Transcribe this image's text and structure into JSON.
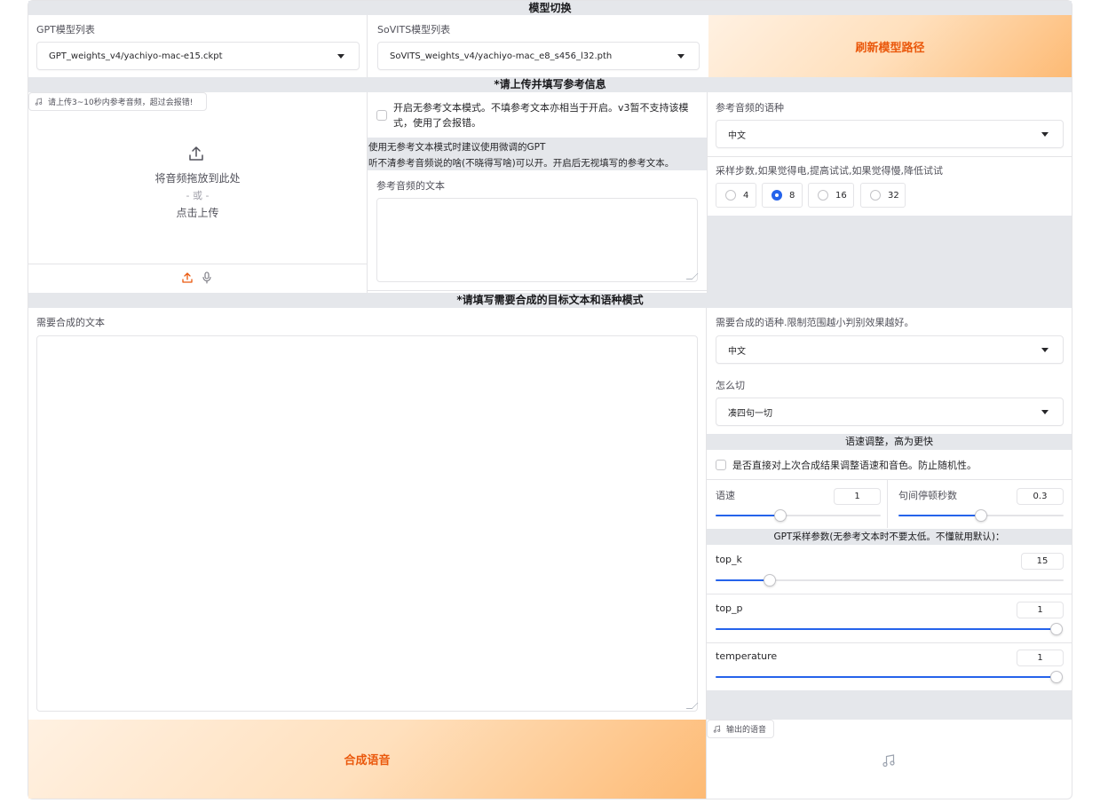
{
  "header": {
    "title": "模型切换"
  },
  "models": {
    "gpt_label": "GPT模型列表",
    "gpt_value": "GPT_weights_v4/yachiyo-mac-e15.ckpt",
    "sovits_label": "SoVITS模型列表",
    "sovits_value": "SoVITS_weights_v4/yachiyo-mac_e8_s456_l32.pth",
    "refresh_label": "刷新模型路径"
  },
  "reference": {
    "section_title": "*请上传并填写参考信息",
    "upload_tag": "请上传3~10秒内参考音频，超过会报错!",
    "drop_text": "将音频拖放到此处",
    "or_text": "- 或 -",
    "click_text": "点击上传",
    "no_ref_checkbox_label": "开启无参考文本模式。不填参考文本亦相当于开启。v3暂不支持该模式，使用了会报错。",
    "hint_line1": "使用无参考文本模式时建议使用微调的GPT",
    "hint_line2": "听不清参考音频说的啥(不晓得写啥)可以开。开启后无视填写的参考文本。",
    "ref_text_label": "参考音频的文本",
    "ref_text_value": "",
    "ref_lang_label": "参考音频的语种",
    "ref_lang_value": "中文",
    "steps_label": "采样步数,如果觉得电,提高试试,如果觉得慢,降低试试",
    "steps_options": [
      "4",
      "8",
      "16",
      "32"
    ],
    "steps_selected": "8"
  },
  "target": {
    "section_title": "*请填写需要合成的目标文本和语种模式",
    "text_label": "需要合成的文本",
    "text_value": "",
    "lang_label": "需要合成的语种.限制范围越小判别效果越好。",
    "lang_value": "中文",
    "cut_label": "怎么切",
    "cut_value": "凑四句一切",
    "speed_section": "语速调整，高为更快",
    "adjust_checkbox_label": "是否直接对上次合成结果调整语速和音色。防止随机性。",
    "speed_label": "语速",
    "speed_value": "1",
    "speed_fraction": 0.39,
    "pause_label": "句间停顿秒数",
    "pause_value": "0.3",
    "pause_fraction": 0.5,
    "gpt_params_section": "GPT采样参数(无参考文本时不要太低。不懂就用默认)：",
    "top_k_label": "top_k",
    "top_k_value": "15",
    "top_k_fraction": 0.155,
    "top_p_label": "top_p",
    "top_p_value": "1",
    "top_p_fraction": 1.0,
    "temperature_label": "temperature",
    "temperature_value": "1",
    "temperature_fraction": 1.0,
    "synth_button": "合成语音",
    "output_tag": "输出的语音"
  },
  "colors": {
    "accent": "#2563eb",
    "orange_text": "#ea580c",
    "section_bg": "#e5e7eb"
  },
  "icons": [
    "music-note-icon",
    "upload-icon",
    "microphone-icon",
    "chevron-down-icon"
  ]
}
